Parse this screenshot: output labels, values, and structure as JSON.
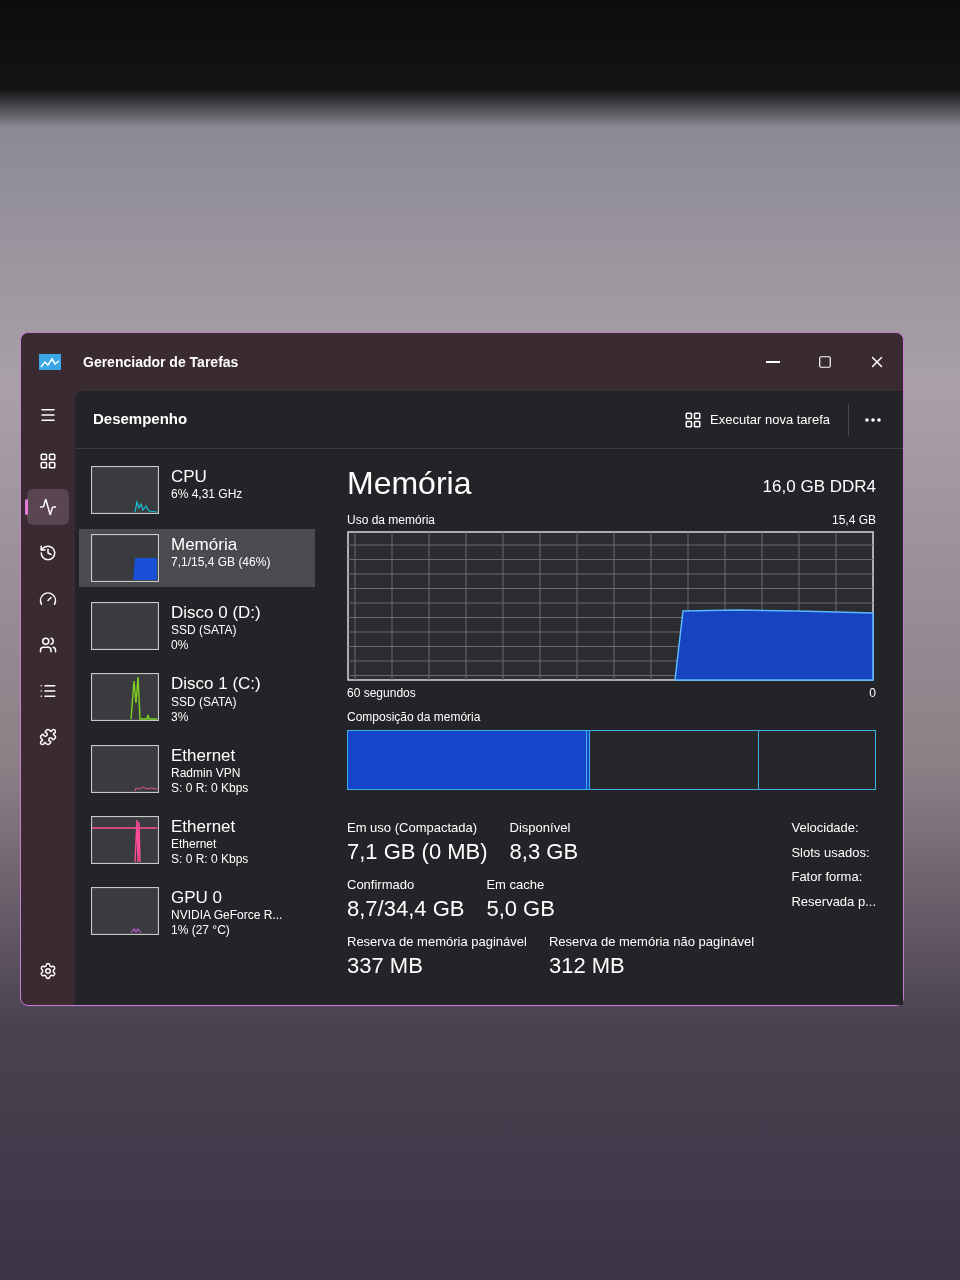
{
  "window": {
    "title": "Gerenciador de Tarefas"
  },
  "nav": [
    {
      "kind": "menu",
      "selected": false
    },
    {
      "kind": "processes",
      "selected": false
    },
    {
      "kind": "performance",
      "selected": true
    },
    {
      "kind": "history",
      "selected": false
    },
    {
      "kind": "startup",
      "selected": false
    },
    {
      "kind": "users",
      "selected": false
    },
    {
      "kind": "details",
      "selected": false
    },
    {
      "kind": "services",
      "selected": false
    },
    {
      "kind": "settings",
      "selected": false
    }
  ],
  "header": {
    "title": "Desempenho",
    "run_task": "Executar nova tarefa"
  },
  "devices": [
    {
      "kind": "cpu",
      "name": "CPU",
      "lines": [
        "6% 4,31 GHz"
      ],
      "selected": false
    },
    {
      "kind": "memory",
      "name": "Memória",
      "lines": [
        "7,1/15,4 GB (46%)"
      ],
      "selected": true
    },
    {
      "kind": "disk_idle",
      "name": "Disco 0 (D:)",
      "lines": [
        "SSD (SATA)",
        "0%"
      ],
      "selected": false
    },
    {
      "kind": "disk",
      "name": "Disco 1 (C:)",
      "lines": [
        "SSD (SATA)",
        "3%"
      ],
      "selected": false
    },
    {
      "kind": "network_idle",
      "name": "Ethernet",
      "lines": [
        "Radmin VPN",
        "S: 0 R: 0 Kbps"
      ],
      "selected": false
    },
    {
      "kind": "network",
      "name": "Ethernet",
      "lines": [
        "Ethernet",
        "S: 0 R: 0 Kbps"
      ],
      "selected": false
    },
    {
      "kind": "gpu",
      "name": "GPU 0",
      "lines": [
        "NVIDIA GeForce R...",
        "1% (27 °C)"
      ],
      "selected": false
    }
  ],
  "detail": {
    "title": "Memória",
    "subtitle": "16,0 GB DDR4",
    "usage_label": "Uso da memória",
    "usage_max": "15,4 GB",
    "time_label": "60 segundos",
    "time_end": "0",
    "composition_label": "Composição da memória",
    "composition": {
      "level": 0.46
    },
    "stats": [
      [
        {
          "label": "Em uso (Compactada)",
          "value": "7,1 GB (0 MB)"
        },
        {
          "label": "Disponível",
          "value": "8,3 GB"
        }
      ],
      [
        {
          "label": "Confirmado",
          "value": "8,7/34,4 GB"
        },
        {
          "label": "Em cache",
          "value": "5,0 GB"
        }
      ],
      [
        {
          "label": "Reserva de memória paginável",
          "value": "337 MB"
        },
        {
          "label": "Reserva de memória não paginável",
          "value": "312 MB"
        }
      ]
    ],
    "properties": [
      "Velocidade:",
      "Slots usados:",
      "Fator forma:",
      "Reservada p..."
    ]
  }
}
